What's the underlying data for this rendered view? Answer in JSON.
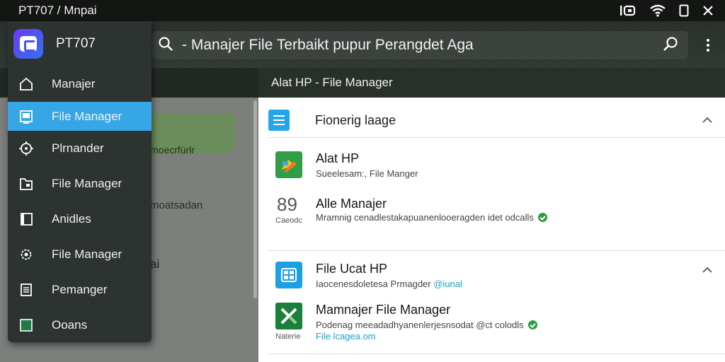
{
  "status_bar": {
    "title": "PT707 / Mnpai",
    "icons": [
      "nfc-icon",
      "wifi-icon",
      "battery-icon",
      "close-icon"
    ]
  },
  "search": {
    "value": "- Manajer File Terbaikt pupur Perangdet Aga"
  },
  "drawer": {
    "app_name": "PT707",
    "items": [
      {
        "label": "Manajer",
        "icon": "home-icon"
      },
      {
        "label": "File Manager",
        "icon": "file-manager-icon",
        "active": true
      },
      {
        "label": "Plrnander",
        "icon": "location-icon"
      },
      {
        "label": "File Manager",
        "icon": "folder-icon"
      },
      {
        "label": "Anidles",
        "icon": "book-icon"
      },
      {
        "label": "File Manager",
        "icon": "settings-icon"
      },
      {
        "label": "Pemanger",
        "icon": "list-icon"
      },
      {
        "label": "Ooans",
        "icon": "green-square-icon"
      }
    ]
  },
  "background_pane": {
    "blob_text": "moecrfürlr",
    "text1": "moatsadan",
    "text2": "ai"
  },
  "content": {
    "header": "Alat HP - File Manager",
    "section1": {
      "title": "Fionerig laage",
      "items": [
        {
          "title": "Alat HP",
          "subtitle": "Sueelesam:, File Manger"
        },
        {
          "title": "Alle Manajer",
          "subtitle": "Mramnig cenadlestakapuanenlooeragden idet odcalls",
          "icon_text": "89",
          "caption": "Caeodc"
        }
      ]
    },
    "section2": {
      "items": [
        {
          "title": "File Ucat HP",
          "subtitle": "Iaocenesdoletesa Prmagder",
          "subtitle_accent": "@iunal"
        },
        {
          "title": "Mamnajer File Manager",
          "subtitle": "Podenag meeadadhyanenlerjesnsodat @ct colodls",
          "subtitle2": "File lcagea.om",
          "caption": "Naterie"
        }
      ]
    }
  },
  "colors": {
    "accent": "#35a7e7",
    "success": "#2e9c42",
    "drawer_bg": "#2d3330"
  }
}
